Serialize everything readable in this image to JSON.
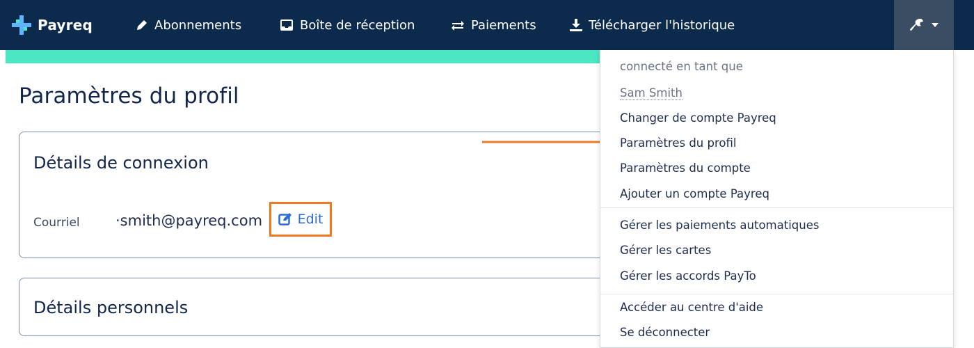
{
  "navbar": {
    "brand": "Payreq",
    "items": [
      {
        "label": "Abonnements",
        "icon": "pencil-icon"
      },
      {
        "label": "Boîte de réception",
        "icon": "inbox-icon"
      },
      {
        "label": "Paiements",
        "icon": "exchange-icon"
      },
      {
        "label": "Télécharger l'historique",
        "icon": "download-icon"
      }
    ],
    "settings_icon": "wrench-icon",
    "colors": {
      "background": "#0b2a4c",
      "accent_strip": "#4be6c2",
      "settings_button": "#3a4d63"
    }
  },
  "main": {
    "page_title": "Paramètres du profil",
    "login_card": {
      "title": "Détails de connexion",
      "email_label": "Courriel",
      "email_value": "·smith@payreq.com",
      "edit_label": "Edit"
    },
    "personal_card": {
      "title": "Détails personnels"
    }
  },
  "dropdown": {
    "header": "connecté en tant que",
    "user_name": "Sam Smith",
    "groups": [
      [
        "Changer de compte Payreq",
        "Paramètres du profil",
        "Paramètres du compte",
        "Ajouter un compte Payreq"
      ],
      [
        "Gérer les paiements automatiques",
        "Gérer les cartes",
        "Gérer les accords PayTo"
      ],
      [
        "Accéder au centre d'aide",
        "Se déconnecter"
      ]
    ]
  },
  "annotation": {
    "highlight_color": "#f07a23"
  }
}
